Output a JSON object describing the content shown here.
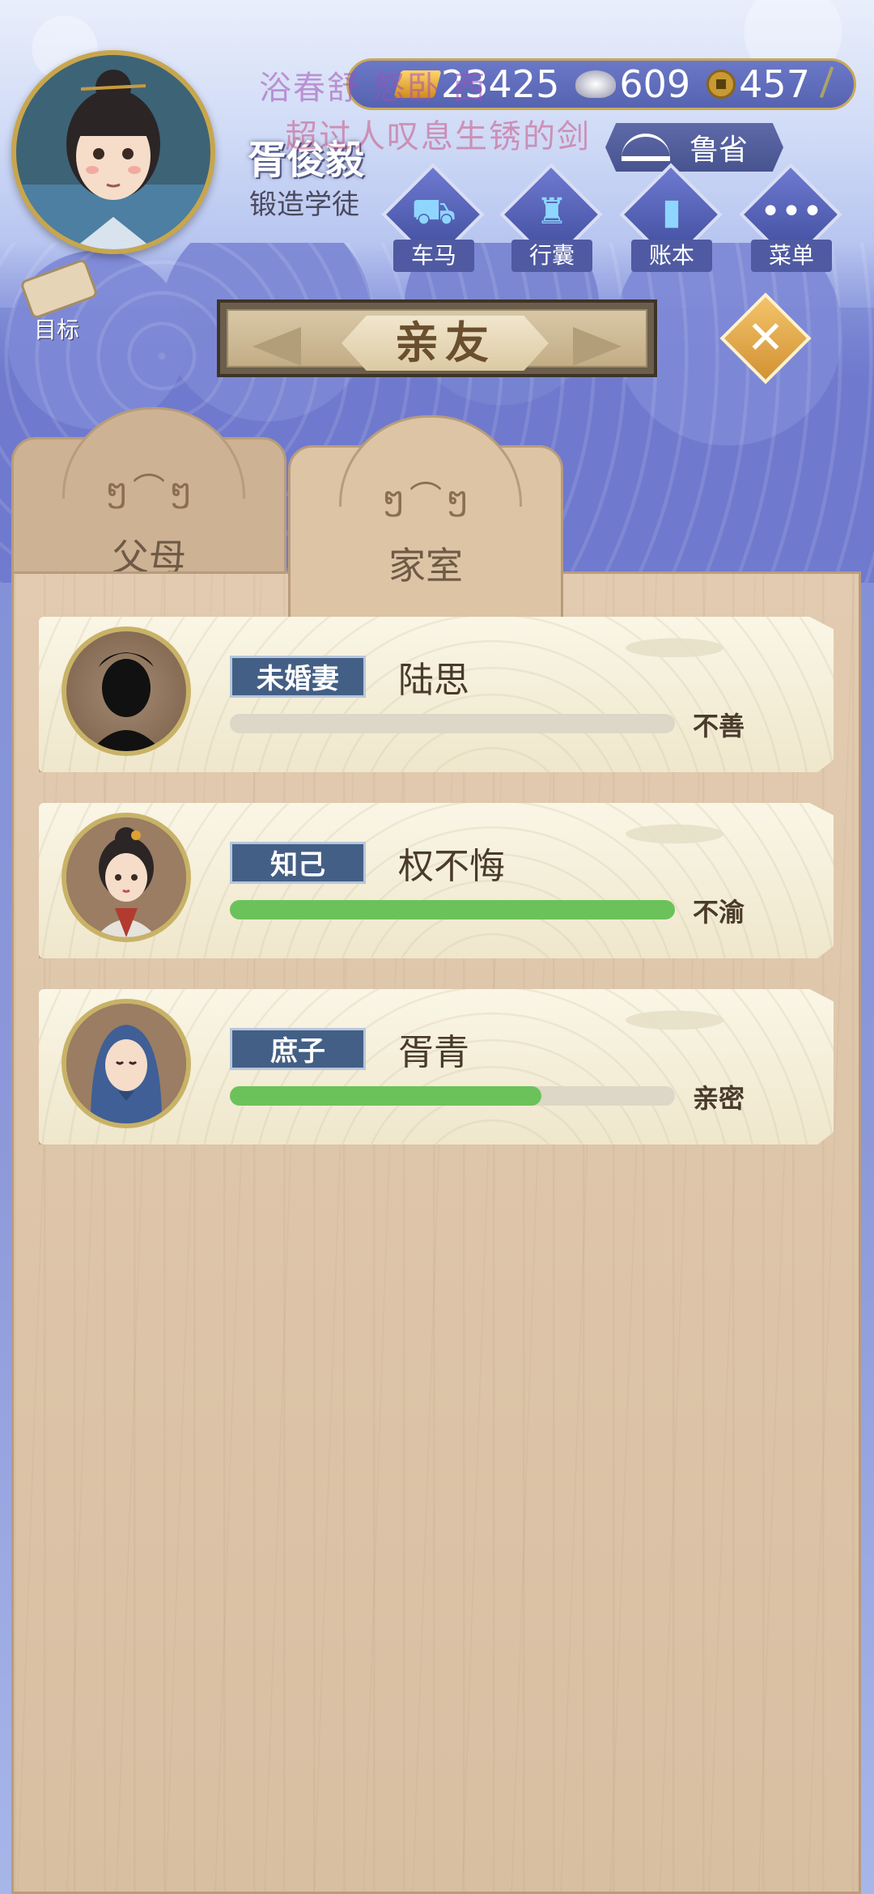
{
  "player": {
    "name": "胥俊毅",
    "title": "锻造学徒"
  },
  "resources": {
    "gold": "23425",
    "silver": "609",
    "coins": "457"
  },
  "overlay_text": {
    "line1": "浴春舒   怒卧   西",
    "line2": "超过人叹息生锈的剑"
  },
  "region": "鲁省",
  "menu": {
    "carriage": "车马",
    "luggage": "行囊",
    "ledger": "账本",
    "menu": "菜单"
  },
  "goal_label": "目标",
  "panel_title": "亲友",
  "tabs": {
    "parents": "父母",
    "family": "家室"
  },
  "relations": [
    {
      "relation": "未婚妻",
      "name": "陆思",
      "status": "不善",
      "affinity": 0.0
    },
    {
      "relation": "知己",
      "name": "权不悔",
      "status": "不渝",
      "affinity": 1.0
    },
    {
      "relation": "庶子",
      "name": "胥青",
      "status": "亲密",
      "affinity": 0.7
    }
  ],
  "colors": {
    "affinity_bar": "#6cc25a",
    "relation_tag": "#445f85",
    "panel_wood": "#e2cbb0"
  }
}
